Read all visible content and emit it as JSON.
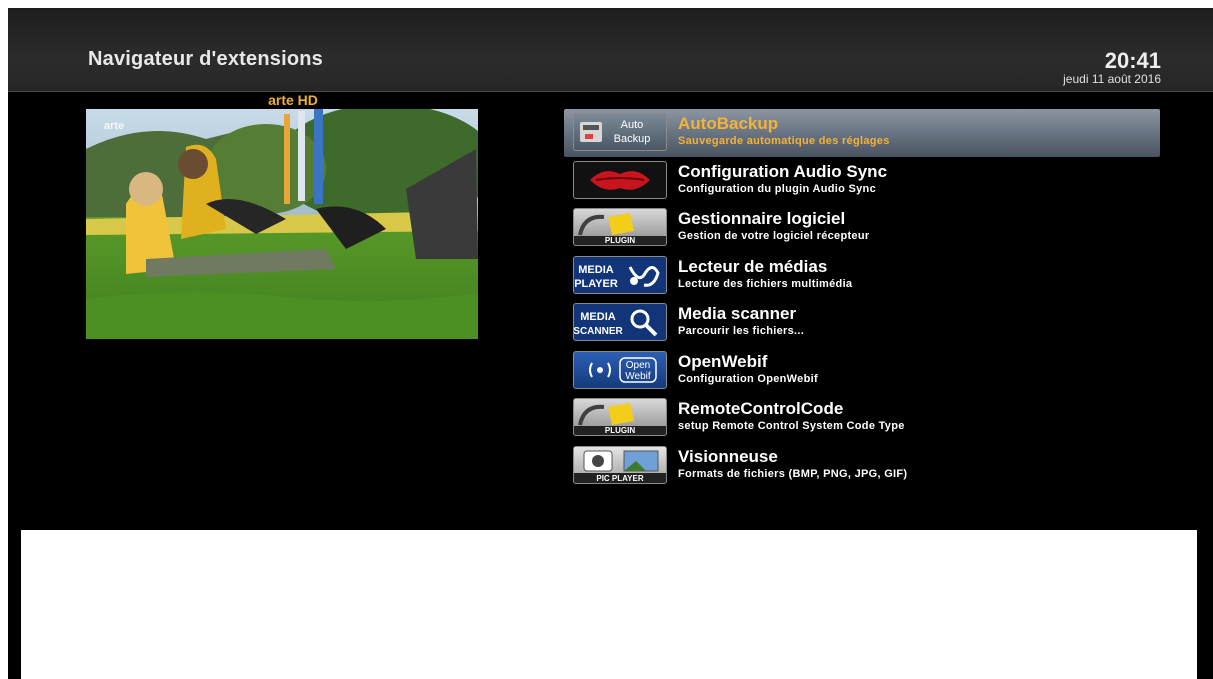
{
  "header": {
    "title": "Navigateur d'extensions",
    "time": "20:41",
    "date": "jeudi 11 août 2016"
  },
  "preview": {
    "channel": "arte HD",
    "logo": "arte"
  },
  "plugins": [
    {
      "name": "AutoBackup",
      "description": "Sauvegarde automatique des réglages",
      "icon": "autobackup-icon",
      "icon_text": [
        "Auto",
        "Backup"
      ],
      "selected": true
    },
    {
      "name": "Configuration Audio Sync",
      "description": "Configuration du plugin Audio Sync",
      "icon": "audio-sync-lips-icon",
      "selected": false
    },
    {
      "name": "Gestionnaire logiciel",
      "description": "Gestion de votre logiciel récepteur",
      "icon": "plugin-icon",
      "icon_text": [
        "PLUGIN"
      ],
      "selected": false
    },
    {
      "name": "Lecteur de médias",
      "description": "Lecture des fichiers multimédia",
      "icon": "media-player-icon",
      "icon_text": [
        "MEDIA",
        "PLAYER"
      ],
      "selected": false
    },
    {
      "name": "Media scanner",
      "description": "Parcourir les fichiers...",
      "icon": "media-scanner-icon",
      "icon_text": [
        "MEDIA",
        "SCANNER"
      ],
      "selected": false
    },
    {
      "name": "OpenWebif",
      "description": "Configuration OpenWebif",
      "icon": "openwebif-icon",
      "icon_text": [
        "Open",
        "Webif"
      ],
      "selected": false
    },
    {
      "name": "RemoteControlCode",
      "description": "setup Remote Control System Code Type",
      "icon": "plugin-icon",
      "icon_text": [
        "PLUGIN"
      ],
      "selected": false
    },
    {
      "name": "Visionneuse",
      "description": "Formats de fichiers (BMP, PNG, JPG, GIF)",
      "icon": "pic-player-icon",
      "icon_text": [
        "PIC PLAYER"
      ],
      "selected": false
    }
  ],
  "colors": {
    "selected_text": "#f4b236",
    "channel_label": "#f0b030",
    "text": "#ffffff"
  }
}
